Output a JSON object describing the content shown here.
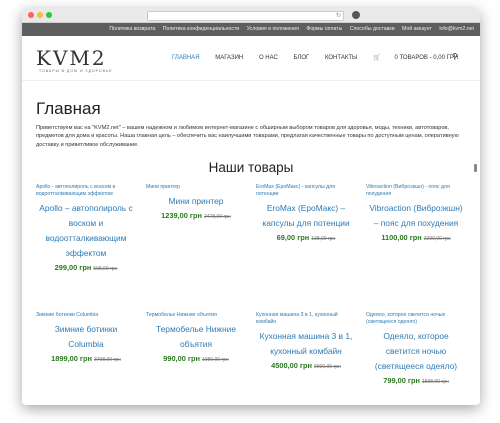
{
  "topbar": [
    "Политика возврата",
    "Политика конфиденциальности",
    "Условия и положения",
    "Формы оплаты",
    "Способы доставки",
    "Мой аккаунт",
    "info@kvm2.net"
  ],
  "logo": {
    "text": "KVM2",
    "subtitle": "ТОВАРЫ В ДОМ И ЗДОРОВЬЕ"
  },
  "nav": [
    "ГЛАВНАЯ",
    "МАГАЗИН",
    "О НАС",
    "БЛОГ",
    "КОНТАКТЫ"
  ],
  "cart": "0 ТОВАРОВ - 0,00 ГРН",
  "page": {
    "title": "Главная",
    "intro": "Приветствуем вас на \"KVM2.net\" – вашем надежном и любимом интернет-магазине с обширным выбором товаров для здоровья, моды, техники, автотоваров, предметов для дома и красоты. Наша главная цель – обеспечить вас наилучшими товарами, предлагая качественные товары по доступным ценам, оперативную доставку и приветливое обслуживание.",
    "section_title": "Наши товары"
  },
  "products": [
    {
      "cat": "Apollo - автополироль с воском и водоотталкивающим эффектом",
      "name": "Apollo – автополироль с воском и водоотталкивающим эффектом",
      "price": "299,00 грн",
      "old": "598,00 грн"
    },
    {
      "cat": "Мини принтер",
      "name": "Мини принтер",
      "price": "1239,00 грн",
      "old": "2478,00 грн"
    },
    {
      "cat": "EroMax (ЕроМакс) - капсулы для потенции",
      "name": "EroMax (ЕроМакс) – капсулы для потенции",
      "price": "69,00 грн",
      "old": "138,00 грн"
    },
    {
      "cat": "Vibroaction (Виброэкшн) - пояс для похудения",
      "name": "Vibroaction (Виброэкшн) – пояс для похудения",
      "price": "1100,00 грн",
      "old": "2200,00 грн"
    },
    {
      "cat": "Зимние ботинки Columbia",
      "name": "Зимние ботинки Columbia",
      "price": "1899,00 грн",
      "old": "3798,00 грн"
    },
    {
      "cat": "Термобелье Нижние объятия",
      "name": "Термобелье Нижние объятия",
      "price": "990,00 грн",
      "old": "1980,00 грн"
    },
    {
      "cat": "Кухонная машина 3 в 1, кухонный комбайн",
      "name": "Кухонная машина 3 в 1, кухонный комбайн",
      "price": "4500,00 грн",
      "old": "9000,00 грн"
    },
    {
      "cat": "Одеяло, которое светится ночью (светящееся одеяло)",
      "name": "Одеяло, которое светится ночью (светящееся одеяло)",
      "price": "799,00 грн",
      "old": "1598,00 грн"
    }
  ]
}
